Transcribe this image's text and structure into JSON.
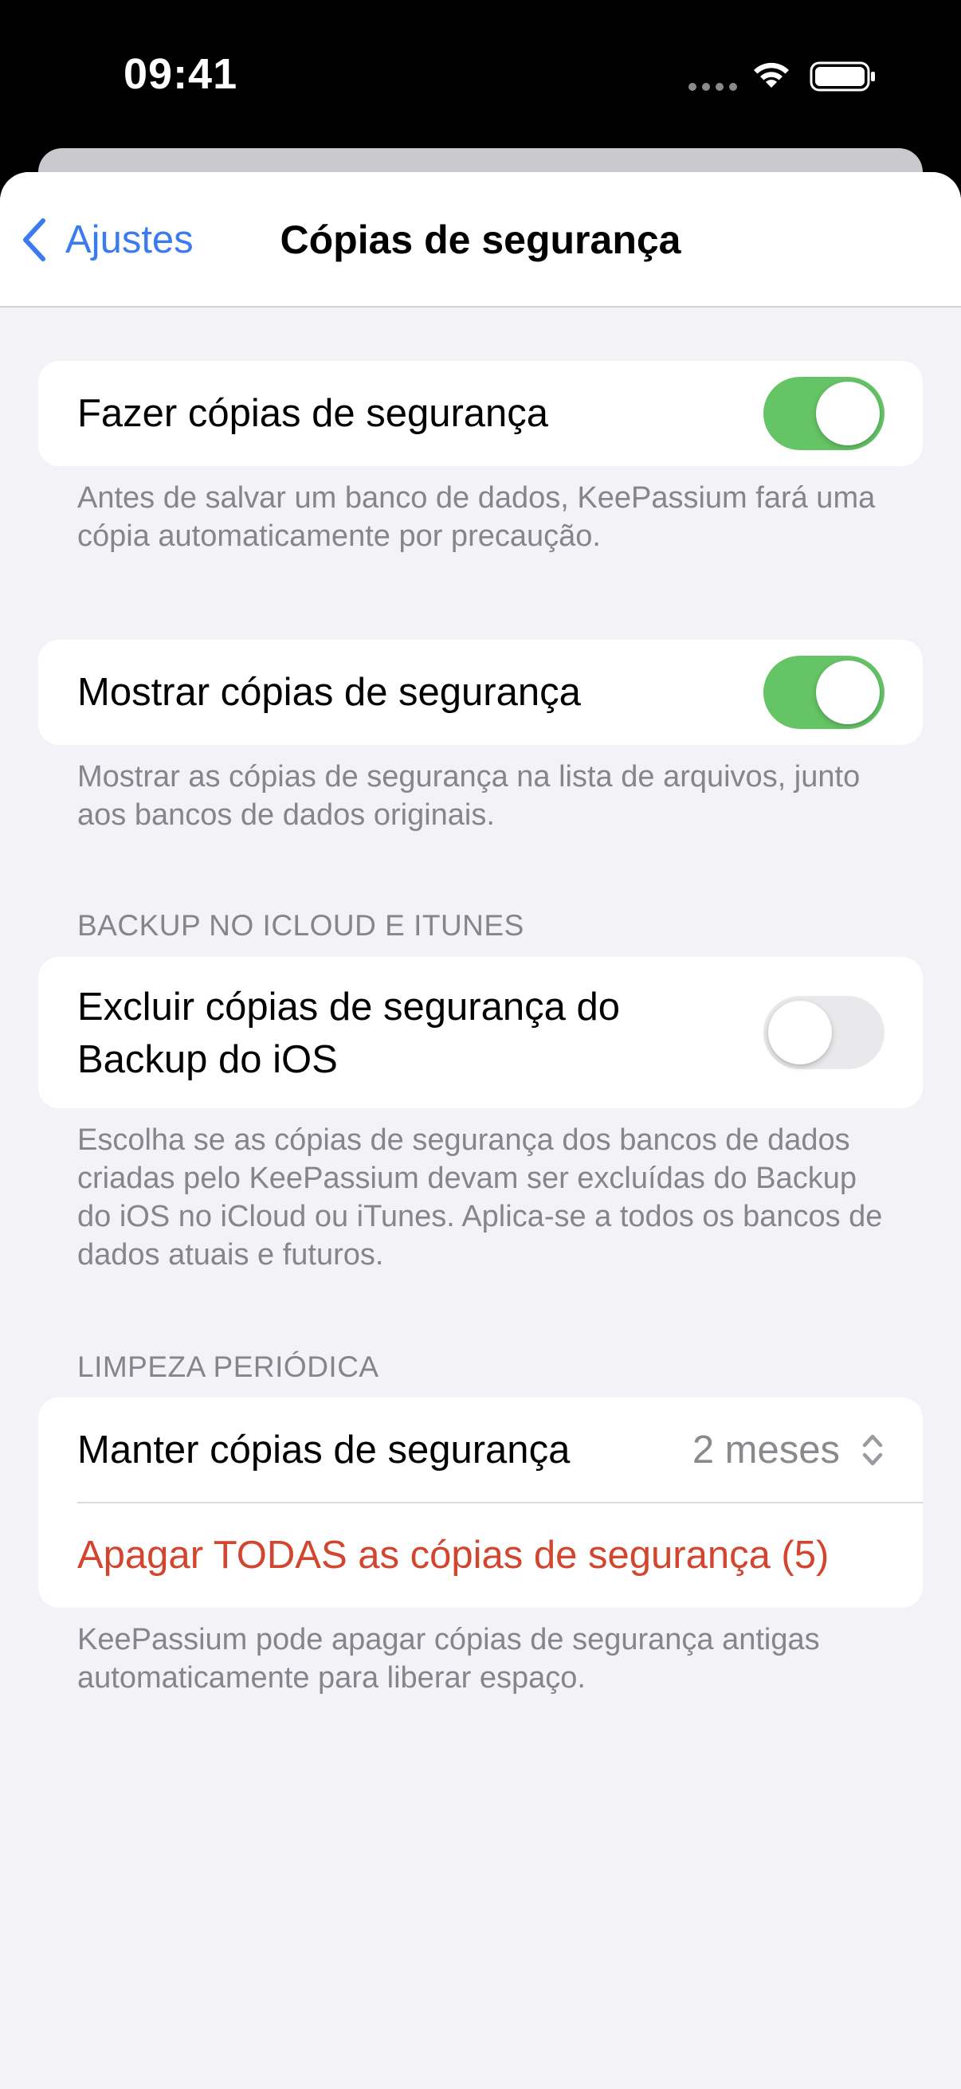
{
  "status_bar": {
    "time": "09:41"
  },
  "nav": {
    "back_label": "Ajustes",
    "title": "Cópias de segurança"
  },
  "section_make_backups": {
    "label": "Fazer cópias de segurança",
    "enabled": true,
    "footer": "Antes de salvar um banco de dados, KeePassium fará uma cópia automaticamente por precaução."
  },
  "section_show_backups": {
    "label": "Mostrar cópias de segurança",
    "enabled": true,
    "footer": "Mostrar as cópias de segurança na lista de arquivos, junto aos bancos de dados originais."
  },
  "section_icloud": {
    "header": "BACKUP NO ICLOUD E ITUNES",
    "label_line1": "Excluir cópias de segurança do",
    "label_line2": "Backup do iOS",
    "enabled": false,
    "footer": "Escolha se as cópias de segurança dos bancos de dados criadas pelo KeePassium devam ser excluídas do Backup do iOS no iCloud ou iTunes. Aplica-se a todos os bancos de dados atuais e futuros."
  },
  "section_cleanup": {
    "header": "LIMPEZA PERIÓDICA",
    "keep_label": "Manter cópias de segurança",
    "keep_value": "2 meses",
    "delete_all_label": "Apagar TODAS as cópias de segurança (5)",
    "footer": "KeePassium pode apagar cópias de segurança antigas automaticamente para liberar espaço."
  },
  "colors": {
    "accent": "#3a7bf0",
    "toggle_on": "#65c466",
    "destructive": "#d2452e",
    "background": "#f2f2f7"
  },
  "icons": [
    "chevron-left-icon",
    "wifi-icon",
    "battery-icon",
    "signal-dots-icon",
    "chevron-up-down-icon"
  ]
}
